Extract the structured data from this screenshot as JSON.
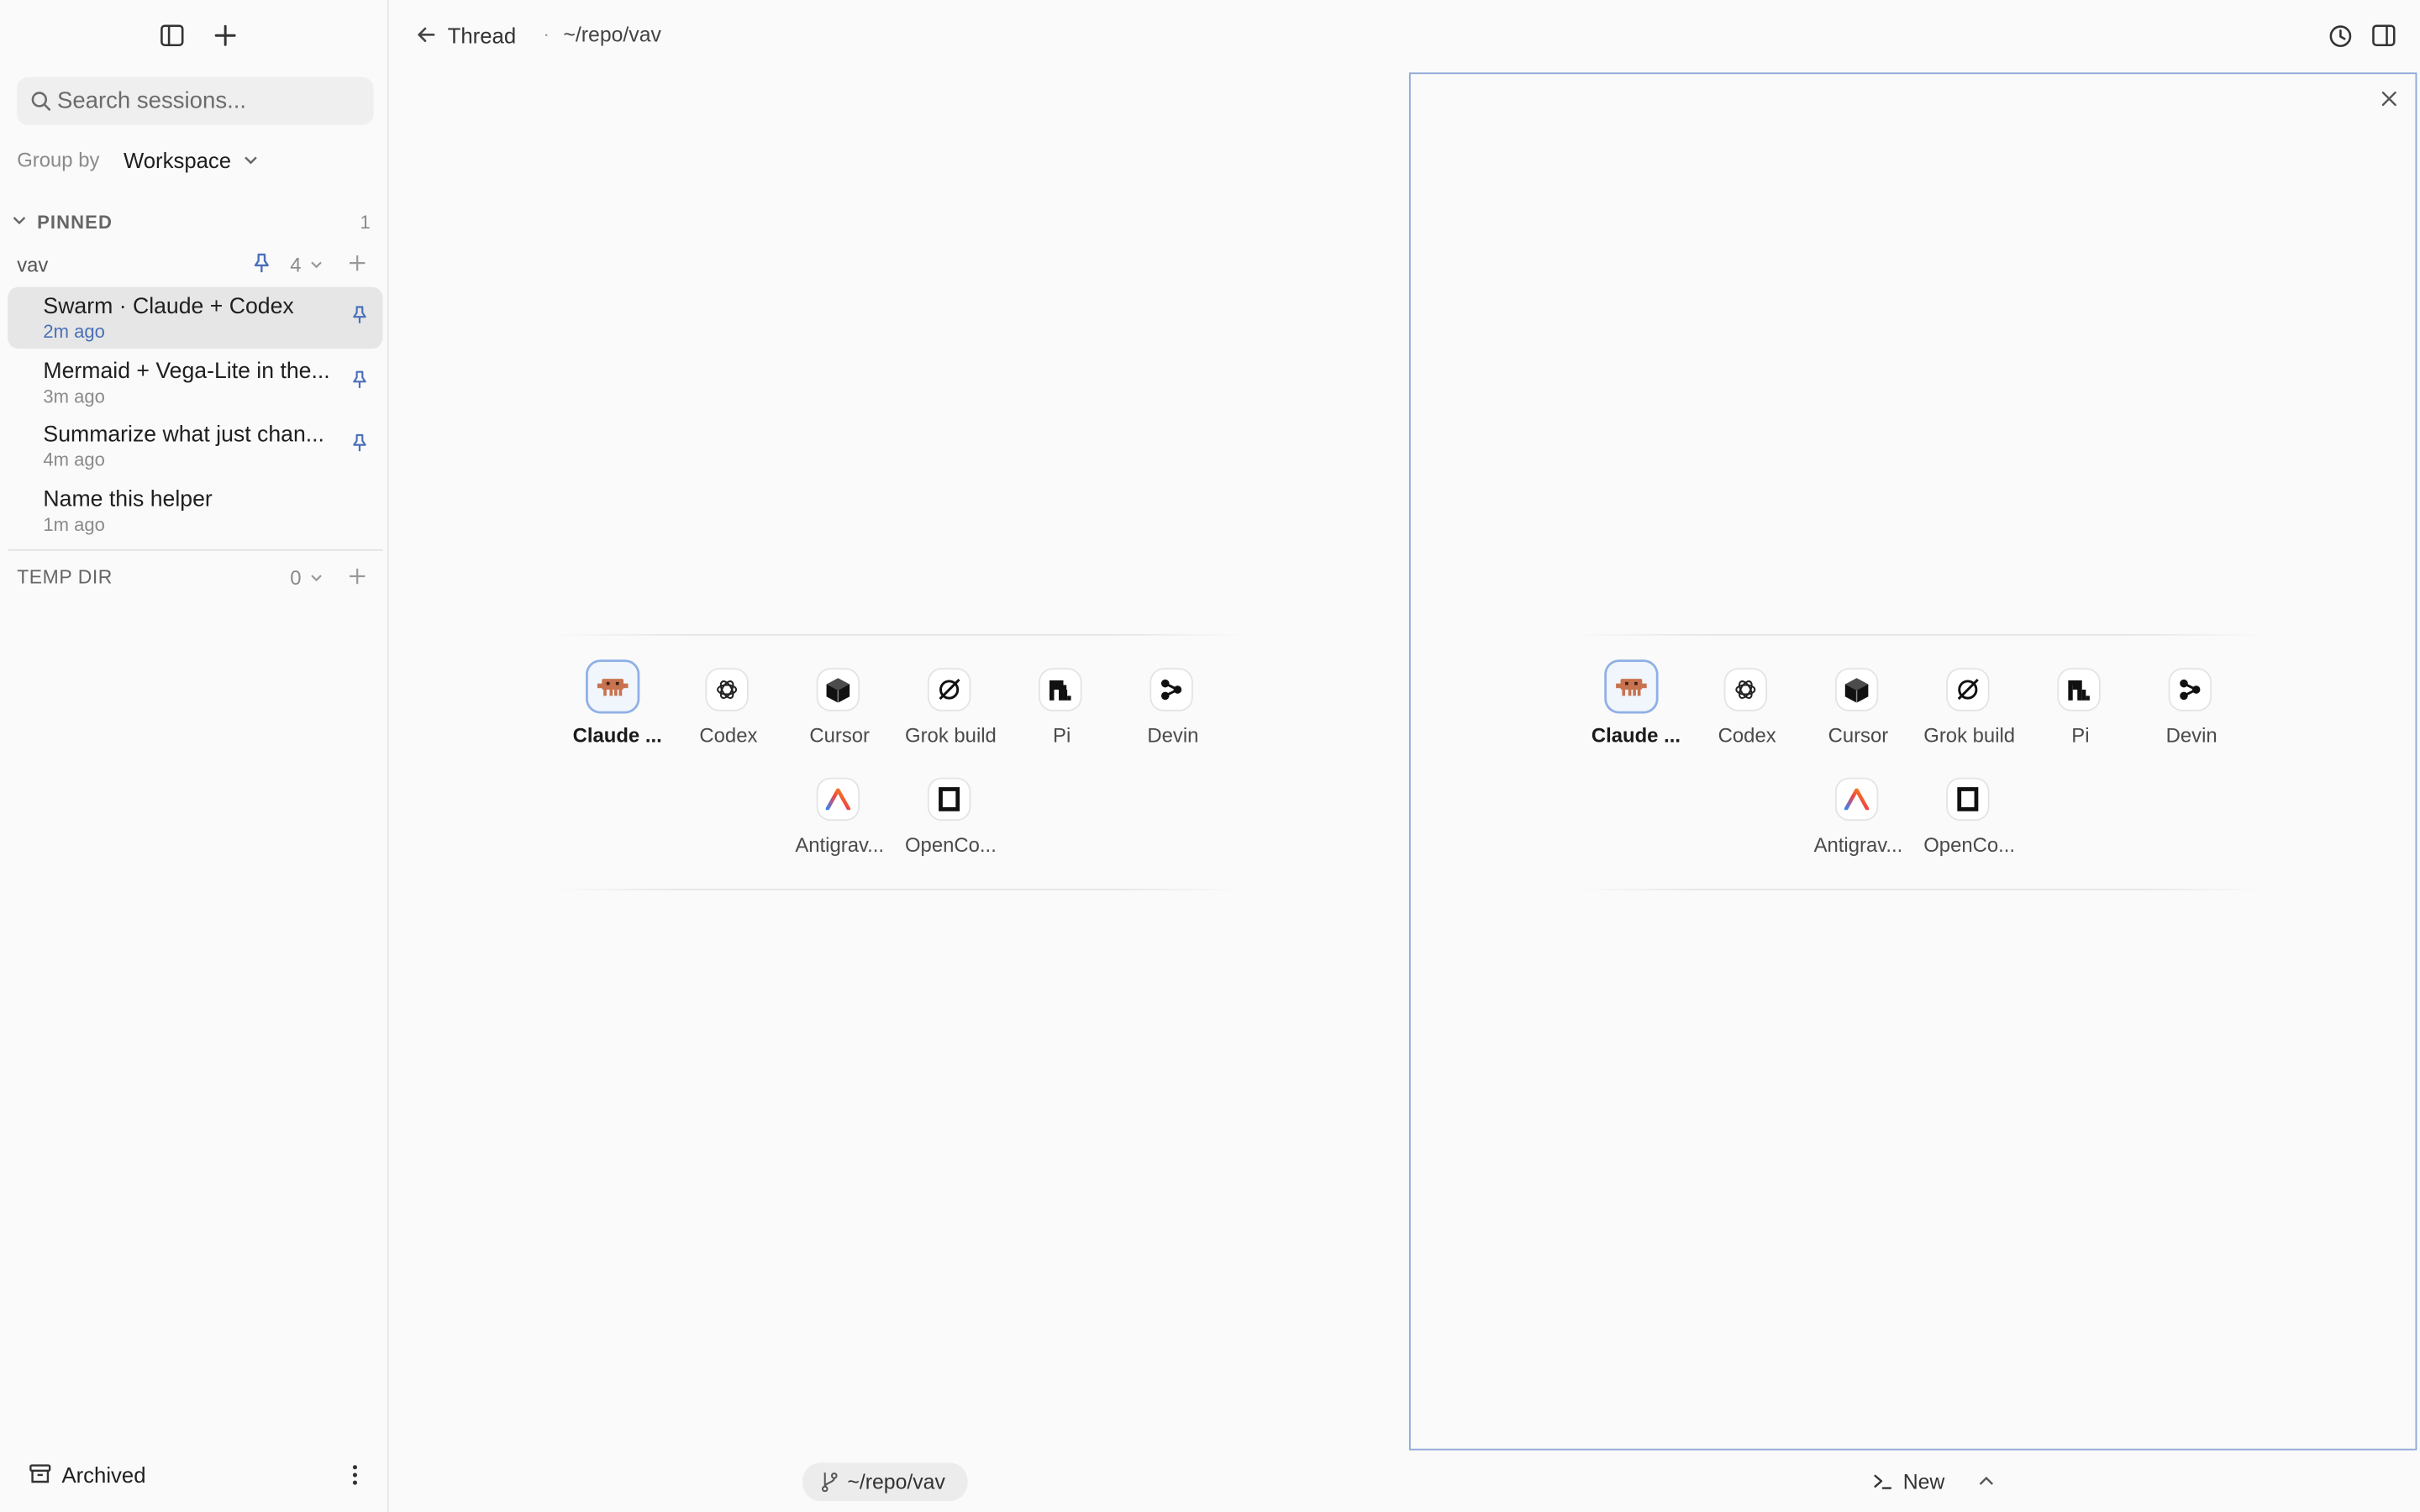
{
  "sidebar": {
    "search_placeholder": "Search sessions...",
    "group_by_label": "Group by",
    "group_by_value": "Workspace",
    "pinned_label": "PINNED",
    "pinned_count": "1",
    "workspace": {
      "name": "vav",
      "count": "4"
    },
    "sessions": [
      {
        "title": "Swarm · Claude + Codex",
        "time": "2m ago",
        "pinned": true
      },
      {
        "title": "Mermaid + Vega-Lite in the...",
        "time": "3m ago",
        "pinned": true
      },
      {
        "title": "Summarize what just chan...",
        "time": "4m ago",
        "pinned": true
      },
      {
        "title": "Name this helper",
        "time": "1m ago",
        "pinned": false
      }
    ],
    "temp_dir": {
      "label": "TEMP DIR",
      "count": "0"
    },
    "archived_label": "Archived"
  },
  "header": {
    "back_label": "Thread",
    "separator": "·",
    "path": "~/repo/vav"
  },
  "agents": [
    "Claude ...",
    "Codex",
    "Cursor",
    "Grok build",
    "Pi",
    "Devin",
    "Antigrav...",
    "OpenCo..."
  ],
  "footer": {
    "branch_path": "~/repo/vav",
    "new_label": "New"
  },
  "colors": {
    "accent": "#4a6fb8",
    "pane_border": "#8fa9d9",
    "claude_brand": "#c8734f",
    "active_session_bg": "#e6e6e6"
  }
}
